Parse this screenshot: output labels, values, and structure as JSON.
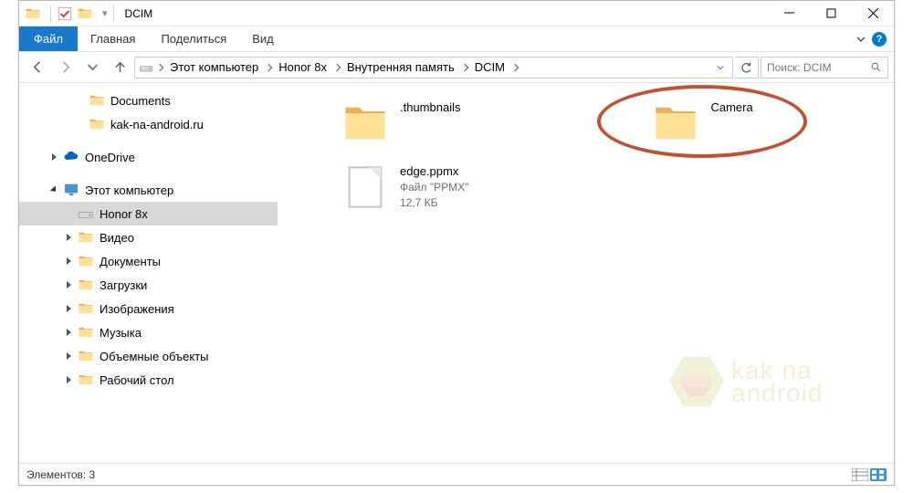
{
  "title": "DCIM",
  "ribbon": {
    "file": "Файл",
    "tabs": [
      "Главная",
      "Поделиться",
      "Вид"
    ]
  },
  "breadcrumb": [
    "Этот компьютер",
    "Honor 8x",
    "Внутренняя память",
    "DCIM"
  ],
  "search_placeholder": "Поиск: DCIM",
  "tree": [
    {
      "indent": 60,
      "icon": "folder",
      "label": "Documents",
      "exp": ""
    },
    {
      "indent": 60,
      "icon": "folder",
      "label": "kak-na-android.ru",
      "exp": ""
    },
    {
      "indent": 32,
      "icon": "onedrive",
      "label": "OneDrive",
      "exp": "closed"
    },
    {
      "indent": 32,
      "icon": "pc",
      "label": "Этот компьютер",
      "exp": "open"
    },
    {
      "indent": 48,
      "icon": "drive",
      "label": "Honor 8x",
      "exp": "",
      "selected": true
    },
    {
      "indent": 48,
      "icon": "folder-vid",
      "label": "Видео",
      "exp": "closed"
    },
    {
      "indent": 48,
      "icon": "folder-doc",
      "label": "Документы",
      "exp": "closed"
    },
    {
      "indent": 48,
      "icon": "folder-dl",
      "label": "Загрузки",
      "exp": "closed"
    },
    {
      "indent": 48,
      "icon": "folder-img",
      "label": "Изображения",
      "exp": "closed"
    },
    {
      "indent": 48,
      "icon": "folder-mus",
      "label": "Музыка",
      "exp": "closed"
    },
    {
      "indent": 48,
      "icon": "folder-3d",
      "label": "Объемные объекты",
      "exp": "closed"
    },
    {
      "indent": 48,
      "icon": "folder-desk",
      "label": "Рабочий стол",
      "exp": "closed"
    }
  ],
  "items": [
    {
      "icon": "folder",
      "name": ".thumbnails"
    },
    {
      "icon": "folder",
      "name": "Camera",
      "highlighted": true
    },
    {
      "icon": "file",
      "name": "edge.ppmx",
      "type": "Файл \"PPMX\"",
      "size": "12,7 КБ"
    }
  ],
  "status_label": "Элементов:",
  "status_count": "3",
  "watermark": {
    "line1": "kak na",
    "line2": "android"
  }
}
